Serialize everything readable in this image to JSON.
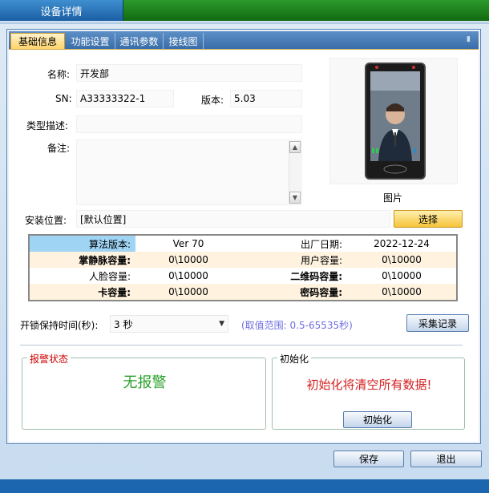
{
  "window": {
    "title": "设备详情"
  },
  "tabs": [
    {
      "label": "基础信息",
      "active": true
    },
    {
      "label": "功能设置",
      "active": false
    },
    {
      "label": "通讯参数",
      "active": false
    },
    {
      "label": "接线图",
      "active": false
    }
  ],
  "basic": {
    "name_label": "名称:",
    "name_value": "开发部",
    "sn_label": "SN:",
    "sn_value": "A33333322-1",
    "version_label": "版本:",
    "version_value": "5.03",
    "type_label": "类型描述:",
    "type_value": "",
    "note_label": "备注:",
    "note_value": "",
    "photo_label": "图片",
    "location_label": "安装位置:",
    "location_value": "[默认位置]",
    "select_button": "选择"
  },
  "info_table": {
    "rows": [
      {
        "k1": "算法版本:",
        "v1": "Ver 70",
        "k2": "出厂日期:",
        "v2": "2022-12-24"
      },
      {
        "k1": "掌静脉容量:",
        "v1": "0\\10000",
        "k2": "用户容量:",
        "v2": "0\\10000"
      },
      {
        "k1": "人脸容量:",
        "v1": "0\\10000",
        "k2": "二维码容量:",
        "v2": "0\\10000"
      },
      {
        "k1": "卡容量:",
        "v1": "0\\10000",
        "k2": "密码容量:",
        "v2": "0\\10000"
      }
    ]
  },
  "unlock": {
    "label": "开锁保持时间(秒):",
    "value": "3 秒",
    "hint": "(取值范围: 0.5-65535秒)",
    "collect_button": "采集记录"
  },
  "alarm": {
    "title": "报警状态",
    "status": "无报警",
    "title_color": "#cc0000",
    "status_color": "#2aa02a"
  },
  "init": {
    "title": "初始化",
    "warning": "初始化将清空所有数据!",
    "warning_color": "#d42020",
    "button": "初始化"
  },
  "footer": {
    "save_button": "保存",
    "exit_button": "退出"
  }
}
